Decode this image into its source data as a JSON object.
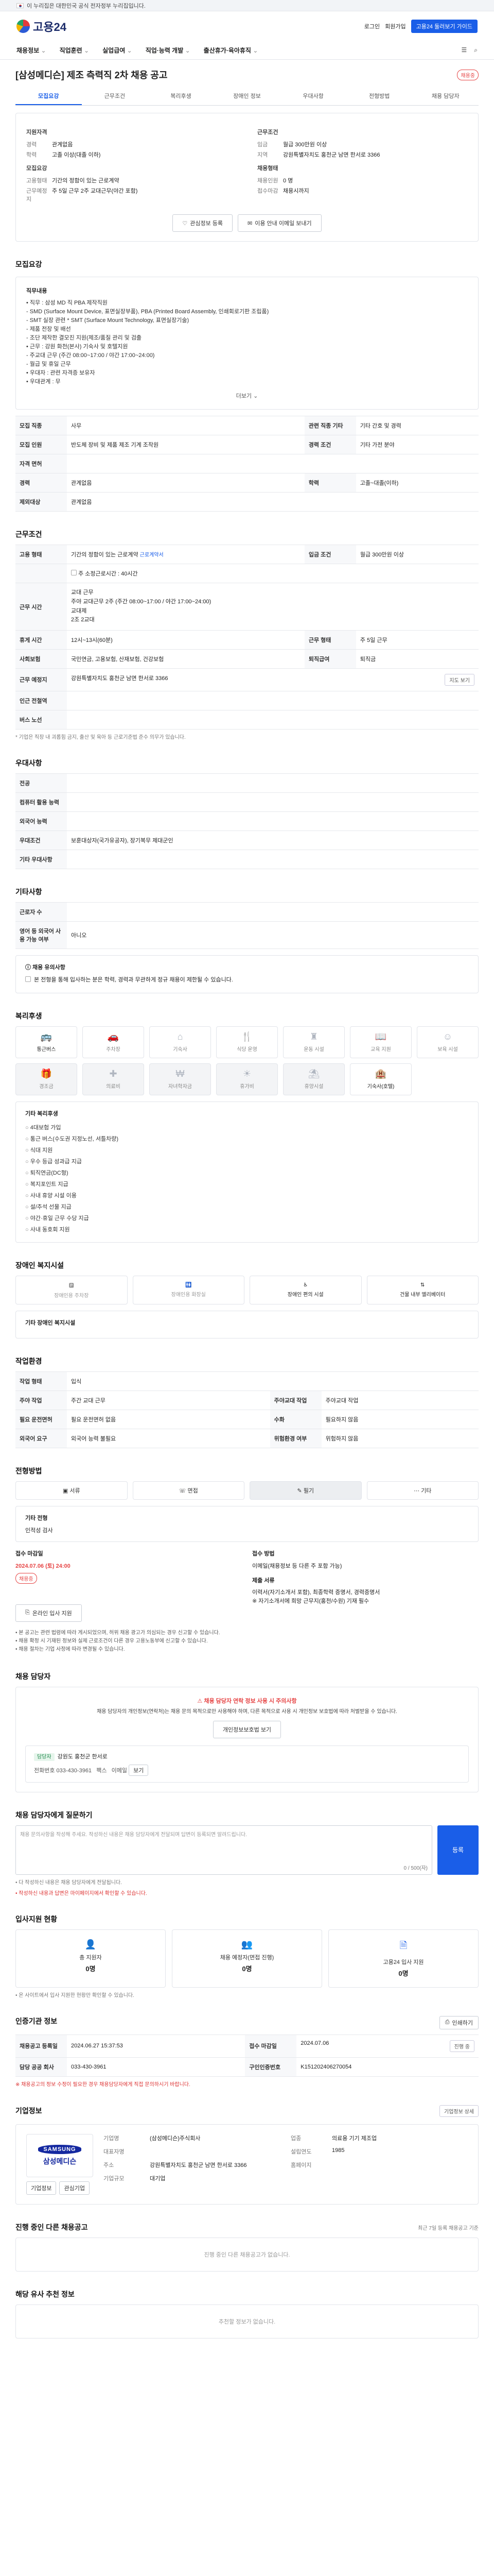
{
  "gov_bar": {
    "text": "이 누리집은 대한민국 공식 전자정부 누리집입니다."
  },
  "header": {
    "logo": "고용24",
    "links": [
      "로그인",
      "회원가입"
    ],
    "cta": "고용24 둘러보기 가이드"
  },
  "gnb": {
    "items": [
      "채용정보",
      "직업훈련",
      "실업급여",
      "직업·능력 개발",
      "출산휴가·육아휴직"
    ],
    "icons": [
      "전체메뉴",
      "검색"
    ]
  },
  "page": {
    "title": "[삼성메디슨] 제조 측력직 2차 채용 공고",
    "badge": "채용중"
  },
  "tabs": [
    "모집요강",
    "근무조건",
    "복리후생",
    "장애인 정보",
    "우대사항",
    "전형방법",
    "채용 담당자"
  ],
  "summary": {
    "left": {
      "h1": "지원자격",
      "rows": [
        {
          "k": "경력",
          "v": "관계없음"
        },
        {
          "k": "학력",
          "v": "고졸 이상(대졸 이하)"
        }
      ],
      "h2": "모집요강",
      "rows2": [
        {
          "k": "고용형태",
          "v": "기간의 정함이 있는 근로계약"
        },
        {
          "k": "근무예정지",
          "v": "주 5일 근무 2주 교대근무(야간 포함)"
        }
      ]
    },
    "right": {
      "h1": "근무조건",
      "rows": [
        {
          "k": "임금",
          "v": "월급 300만원 이상"
        },
        {
          "k": "지역",
          "v": "강원특별자치도 홍천군 남면 한서로 3366"
        }
      ],
      "h2": "채용형태",
      "rows2": [
        {
          "k": "채용인원",
          "v": "0 명"
        },
        {
          "k": "접수마감",
          "v": "채용시까지"
        }
      ]
    },
    "buttons": {
      "interest": "관심정보 등록",
      "print": "이용 안내 이메일 보내기"
    }
  },
  "recruit": {
    "title": "모집요강",
    "duty_label": "직무내용",
    "duty_text": "• 직무 : 삼성 MD 직 PBA 제작직원\n  - SMD (Surface Mount Device, 표면실장부품), PBA (Printed Board Assembly, 인쇄회로기판 조립품)\n  - SMT 실장 관련 * SMT (Surface Mount Technology, 표면실장기술)\n  - 제품 전장 및 배선\n  - 조단 제작한 결모진 지원(제조/품질 관리 및 검출\n• 근무 : 강원 화천(본사) 기숙사 및 호텔지원\n  - 주교대 근무 (주간 08:00~17:00 / 야간 17:00~24:00)\n  - 월급 및 휴일 근무\n• 우대자 : 관련 자격증 보유자\n• 우대관계 : 무",
    "more": "더보기 ⌄",
    "rows": [
      [
        "모집 직종",
        "사무",
        "관련 직종 기타",
        "기타 간호 및 경력"
      ],
      [
        "모집 인원",
        "반도체 장비 및 제품 제조 기계 조작원",
        "경력 조건",
        "기타 가전 분야"
      ],
      [
        "자격 면허",
        "",
        "",
        ""
      ],
      [
        "경력",
        "관계없음",
        "학력",
        "고졸~대졸(이하)"
      ],
      [
        "제외대상",
        "관계없음",
        "",
        ""
      ]
    ]
  },
  "work": {
    "title": "근무조건",
    "rows": [
      {
        "k": "고용 형태",
        "v": "기간의 정함이 있는 근로계약",
        "tag": "근로계약서",
        "k2": "입금 조건",
        "v2": "월급 300만원 이상"
      },
      {
        "k": "",
        "v": "주 소정근로시간 : 40시간",
        "tag": "",
        "k2": "",
        "v2": ""
      },
      {
        "k": "근무 시간",
        "v": "교대 근무\n주야 교대근무 2주 (주간 08:00~17:00 / 야간 17:00~24:00)\n교대제\n2조 2교대",
        "tag": "",
        "k2": "",
        "v2": ""
      },
      {
        "k": "휴게 시간",
        "v": "12시~13시(60분)",
        "tag": "",
        "k2": "근무 형태",
        "v2": "주 5일 근무"
      },
      {
        "k": "사회보험",
        "v": "국민연금, 고용보험, 산재보험, 건강보험",
        "tag": "",
        "k2": "퇴직급여",
        "v2": "퇴직금"
      },
      {
        "k": "근무 예정지",
        "v": "강원특별자치도 홍천군 남면 한서로 3366",
        "tag": "",
        "k2": "",
        "v2": "지도 보기"
      },
      {
        "k": "인근 전철역",
        "v": "",
        "tag": "",
        "k2": "",
        "v2": ""
      },
      {
        "k": "버스 노선",
        "v": "",
        "tag": "",
        "k2": "",
        "v2": ""
      }
    ],
    "note": "* 기업은 직장 내 괴롭힘 금지, 출산 및 육아 등 근로기준법 준수 의무가 있습니다."
  },
  "prefer": {
    "title": "우대사항",
    "rows": [
      [
        "전공",
        ""
      ],
      [
        "컴퓨터 활용 능력",
        ""
      ],
      [
        "외국어 능력",
        ""
      ],
      [
        "우대조건",
        "보훈대상자(국가유공자), 장기복무 제대군인"
      ],
      [
        "기타 우대사항",
        ""
      ]
    ]
  },
  "etc": {
    "title": "기타사항",
    "rows": [
      [
        "근로자 수",
        ""
      ],
      [
        "영어 등 외국어 사용 가능 여부",
        "아니오"
      ]
    ],
    "privacy_label": "ⓘ 채용 유의사항",
    "privacy_checks": [
      "본 전형을 통해 입사하는 분은 학력, 경력과 무관하게 정규 채용이 제한될 수 있습니다."
    ]
  },
  "welfare": {
    "title": "복리후생",
    "items": [
      {
        "icon": "building",
        "label": "통근버스",
        "on": true
      },
      {
        "icon": "car",
        "label": "주차장",
        "on": false
      },
      {
        "icon": "home",
        "label": "기숙사",
        "on": false
      },
      {
        "icon": "food",
        "label": "식당 운영",
        "on": false
      },
      {
        "icon": "gym",
        "label": "운동 시설",
        "on": false
      },
      {
        "icon": "book",
        "label": "교육 지원",
        "on": false
      },
      {
        "icon": "baby",
        "label": "보육 시설",
        "on": false
      },
      {
        "icon": "gift",
        "label": "경조금",
        "on": false
      },
      {
        "icon": "medical",
        "label": "의료비",
        "on": false
      },
      {
        "icon": "fund",
        "label": "자녀학자금",
        "on": false
      },
      {
        "icon": "holiday",
        "label": "휴가비",
        "on": false
      },
      {
        "icon": "rest",
        "label": "휴양시설",
        "on": false
      },
      {
        "icon": "hotel",
        "label": "기숙사(호텔)",
        "on": true
      }
    ],
    "list_title": "기타 복리후생",
    "list": [
      "4대보험 가입",
      "통근 버스(수도권 지정노선, 셔틀차량)",
      "식대 지원",
      "우수 등급 성과급 지급",
      "퇴직연금(DC형)",
      "복지포인트 지급",
      "사내 휴양 시설 이용",
      "설/추석 선물 지급",
      "야간·휴일 근무 수당 지급",
      "사내 동호회 지원"
    ]
  },
  "disability": {
    "title": "장애인 복지시설",
    "items": [
      {
        "label": "장애인용 주차장",
        "on": false
      },
      {
        "label": "장애인용 화장실",
        "on": false
      },
      {
        "label": "장애인 편의 시설",
        "on": true
      },
      {
        "label": "건물 내부 엘리베이터",
        "on": true
      }
    ],
    "box_title": "기타 장애인 복지시설"
  },
  "work_env": {
    "title": "작업환경",
    "rows": [
      [
        "작업 형태",
        "입식",
        "",
        ""
      ],
      [
        "주야 작업",
        "주간 교대 근무",
        "주야교대 작업",
        "주야교대 작업"
      ],
      [
        "필요 운전면허",
        "필요 운전면허 없음",
        "수화",
        "필요하지 않음"
      ],
      [
        "외국어 요구",
        "외국어 능력 불필요",
        "위험환경 여부",
        "위험하지 않음"
      ]
    ]
  },
  "selection": {
    "title": "전형방법",
    "steps": [
      "서류",
      "면접",
      "필기",
      "기타"
    ],
    "gray_index": 2,
    "label": "기타 전형",
    "sub": "인적성 검사",
    "deadline_label": "접수 마감일",
    "deadline": "2024.07.06 (토) 24:00",
    "deadline_badge": "채용중",
    "method_label": "접수 방법",
    "method": "이메일(채용정보 등 다른 주 포함 가능)",
    "docs_label": "제출 서류",
    "docs": "이력서(자기소개서 포함), 최종학력 증명서, 경력증명서\n※ 자기소개서에 희망 근무지(홍천/수원) 기재 필수",
    "apply_btn": "온라인 입사 지원",
    "notice": "• 본 공고는 관련 법령에 따라 게시되었으며, 허위 채용 광고가 의심되는 경우 신고할 수 있습니다.\n• 채용 확정 시 기재된 정보와 실제 근로조건이 다른 경우 고용노동부에 신고할 수 있습니다.\n• 채용 절차는 기업 사정에 따라 변경될 수 있습니다."
  },
  "manager": {
    "title": "채용 담당자",
    "warn": "채용 담당자 연락 정보 사용 시 주의사항",
    "desc": "채용 담당자의 개인정보(연락처)는 채용 문의 목적으로만 사용해야 하며, 다른 목적으로 사용 시 개인정보 보호법에 따라 처벌받을 수 있습니다.",
    "btn": "개인정보보호법 보기",
    "chip": "담당자",
    "name": "강원도 홍천군 한서로",
    "phone_label": "전화번호",
    "phone": "033-430-3961",
    "fax_label": "팩스",
    "fax": "",
    "email_label": "이메일",
    "email_btn": "보기"
  },
  "qa": {
    "title": "채용 담당자에게 질문하기",
    "placeholder": "채용 문의사항을 작성해 주세요. 작성하신 내용은 채용 담당자에게 전달되며 답변이 등록되면 알려드립니다.",
    "count": "0 / 500(자)",
    "btn": "등록",
    "notes": [
      "• 다 작성하신 내용은 채용 담당자에게 전달됩니다.",
      "• 작성하신 내용과 답변은 마이페이지에서 확인할 수 있습니다."
    ]
  },
  "status": {
    "title": "입사지원 현황",
    "cards": [
      {
        "label": "총 지원자",
        "num": "0명"
      },
      {
        "label": "채용 예정자(면접 진행)",
        "num": "0명"
      },
      {
        "label": "고용24 입사 지원",
        "num": "0명"
      }
    ],
    "note": "• 온 사이트에서 입사 지원한 현황만 확인할 수 있습니다."
  },
  "channel": {
    "title": "인증기관 정보",
    "print_btn": "인쇄하기",
    "rows": [
      [
        "채용공고 등록일",
        "2024.06.27 15:37:53",
        "접수 마감일",
        "2024.07.06",
        "진행 중"
      ],
      [
        "담당 공공 회사",
        "033-430-3961",
        "구인인증번호",
        "K151202406270054"
      ]
    ],
    "notice": "※ 채용공고의 정보 수정이 필요한 경우 채용담당자에게 직접 문의하시기 바랍니다."
  },
  "company": {
    "title": "기업정보",
    "logo_en": "SAMSUNG",
    "logo_kr": "삼성메디슨",
    "btns": [
      "기업정보",
      "관심기업"
    ],
    "rows": [
      [
        "기업명",
        "(삼성메디슨)주식회사",
        "업종",
        "의료용 기기 제조업"
      ],
      [
        "대표자명",
        "",
        "설립연도",
        "1985"
      ],
      [
        "주소",
        "강원특별자치도 홍천군 남면 한서로 3366",
        "홈페이지",
        ""
      ],
      [
        "기업규모",
        "대기업",
        "",
        ""
      ]
    ],
    "detail_btn": "기업정보 상세"
  },
  "related": {
    "title": "진행 중인 다른 채용공고",
    "aside": "최근 7일 등록 채용공고 기준",
    "empty": "진행 중인 다른 채용공고가 없습니다."
  },
  "similar": {
    "title": "해당 유사 추천 정보",
    "empty": "추천할 정보가 없습니다."
  }
}
